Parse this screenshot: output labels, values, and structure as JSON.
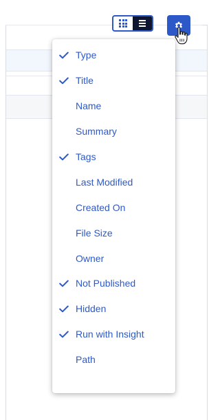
{
  "toolbar": {
    "grid_view_icon": "grid-view-icon",
    "list_view_icon": "list-view-icon",
    "settings_icon": "gear-icon",
    "active_view": "list"
  },
  "column_menu": {
    "items": [
      {
        "label": "Type",
        "checked": true
      },
      {
        "label": "Title",
        "checked": true
      },
      {
        "label": "Name",
        "checked": false
      },
      {
        "label": "Summary",
        "checked": false
      },
      {
        "label": "Tags",
        "checked": true
      },
      {
        "label": "Last Modified",
        "checked": false
      },
      {
        "label": "Created On",
        "checked": false
      },
      {
        "label": "File Size",
        "checked": false
      },
      {
        "label": "Owner",
        "checked": false
      },
      {
        "label": "Not Published",
        "checked": true
      },
      {
        "label": "Hidden",
        "checked": true
      },
      {
        "label": "Run with Insight",
        "checked": true
      },
      {
        "label": "Path",
        "checked": false
      }
    ]
  },
  "colors": {
    "accent": "#2d59c8",
    "dark": "#0d1530"
  }
}
